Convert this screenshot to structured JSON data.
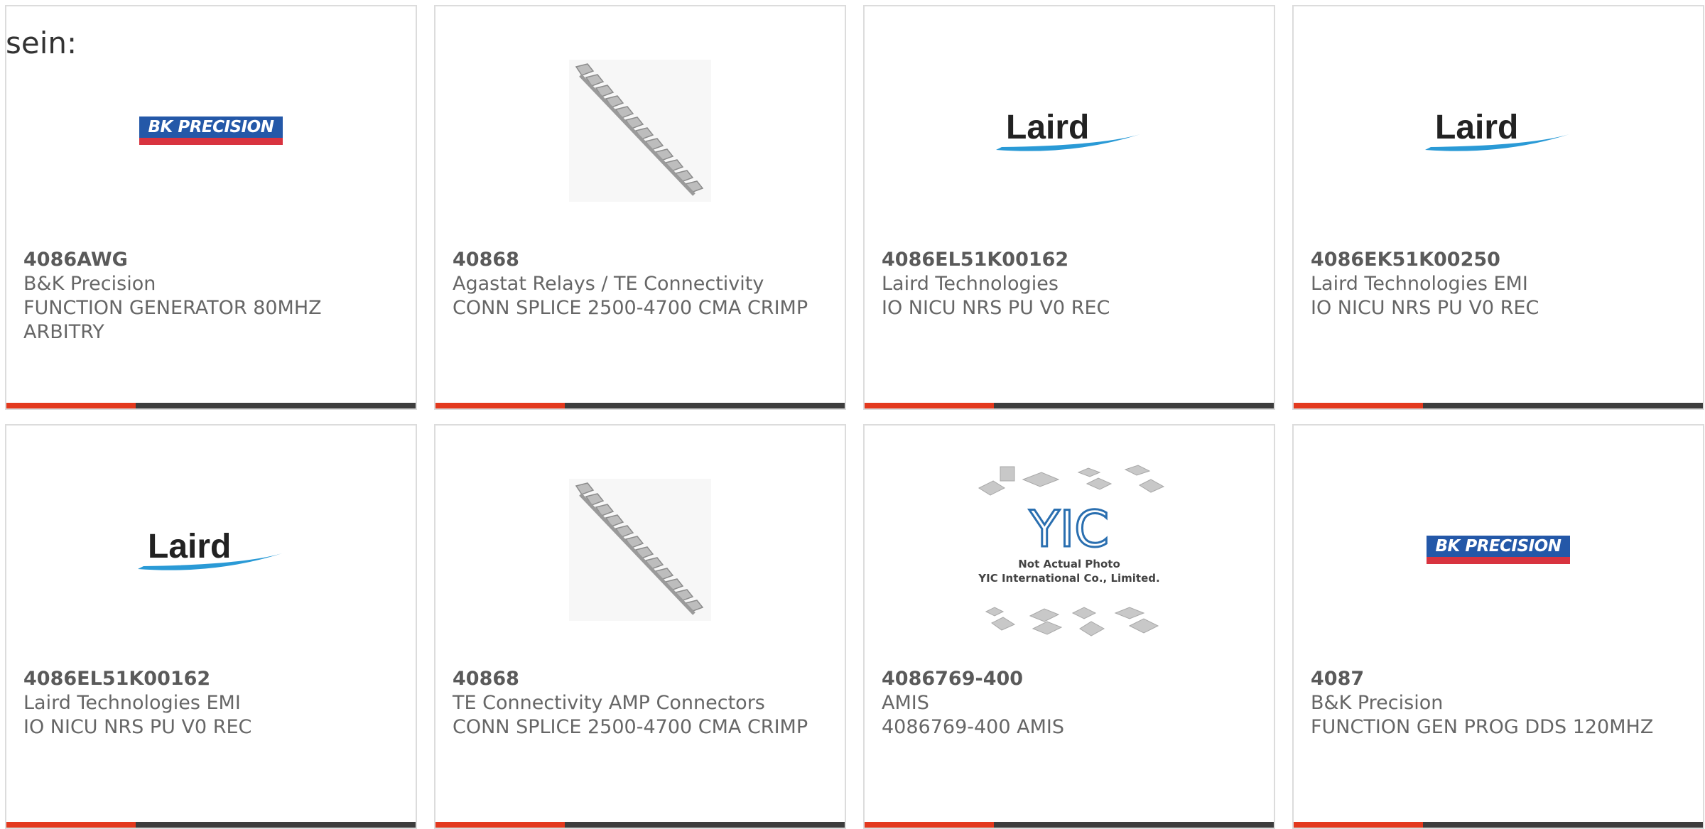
{
  "intro_text": "sein:",
  "colors": {
    "accent": "#e3391e",
    "bar": "#3d3d3d",
    "border": "#dcdcdc",
    "text": "#666666"
  },
  "products": [
    {
      "part": "4086AWG",
      "maker": "B&K Precision",
      "desc": "FUNCTION GENERATOR 80MHZ ARBITRY",
      "image": "bk-precision-logo",
      "logo_text": "BK PRECISION"
    },
    {
      "part": "40868",
      "maker": "Agastat Relays / TE Connectivity",
      "desc": "CONN SPLICE 2500-4700 CMA CRIMP",
      "image": "splice-strip-photo"
    },
    {
      "part": "4086EL51K00162",
      "maker": "Laird Technologies",
      "desc": "IO NICU NRS PU V0 REC",
      "image": "laird-logo",
      "logo_text": "Laird"
    },
    {
      "part": "4086EK51K00250",
      "maker": "Laird Technologies EMI",
      "desc": "IO NICU NRS PU V0 REC",
      "image": "laird-logo",
      "logo_text": "Laird"
    },
    {
      "part": "4086EL51K00162",
      "maker": "Laird Technologies EMI",
      "desc": "IO NICU NRS PU V0 REC",
      "image": "laird-logo",
      "logo_text": "Laird"
    },
    {
      "part": "40868",
      "maker": "TE Connectivity AMP Connectors",
      "desc": "CONN SPLICE 2500-4700 CMA CRIMP",
      "image": "splice-strip-photo"
    },
    {
      "part": "4086769-400",
      "maker": "AMIS",
      "desc": "4086769-400 AMIS",
      "image": "yic-placeholder",
      "logo_text": "YIC",
      "note_line1": "Not Actual Photo",
      "note_line2": "YIC International Co., Limited."
    },
    {
      "part": "4087",
      "maker": "B&K Precision",
      "desc": "FUNCTION GEN PROG DDS 120MHZ",
      "image": "bk-precision-logo",
      "logo_text": "BK PRECISION"
    }
  ]
}
